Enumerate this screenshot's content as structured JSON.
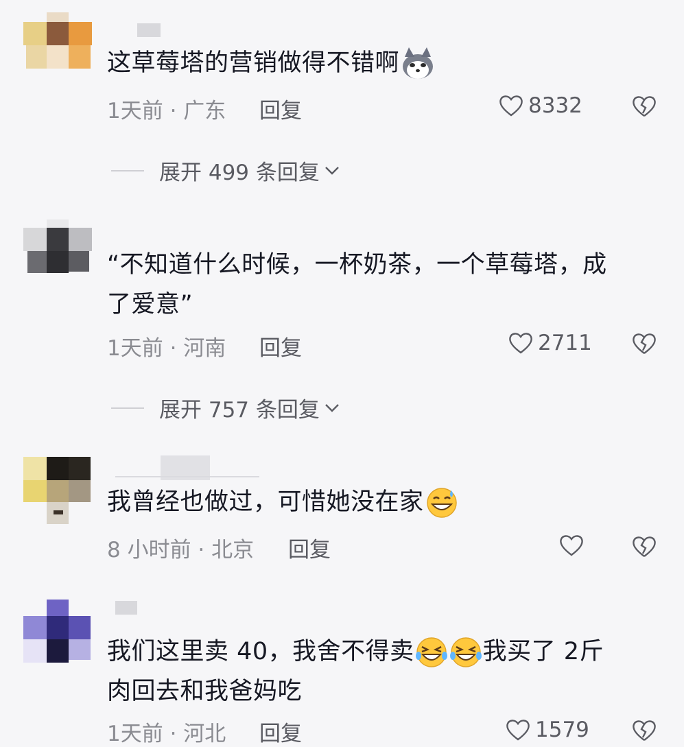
{
  "comments": [
    {
      "text": "这草莓塔的营销做得不错啊",
      "emoji": "husky-dog-emoji",
      "time_location": "1天前 · 广东",
      "reply_label": "回复",
      "likes": "8332",
      "expand_label": "展开 499 条回复"
    },
    {
      "text_line1": "“不知道什么时候，一杯奶茶，一个草莓塔，成",
      "text_line2": "了爱意”",
      "time_location": "1天前 · 河南",
      "reply_label": "回复",
      "likes": "2711",
      "expand_label": "展开 757 条回复"
    },
    {
      "text": "我曾经也做过，可惜她没在家",
      "emoji": "grinning-sweat-emoji",
      "time_location": "8 小时前 · 北京",
      "reply_label": "回复",
      "likes": ""
    },
    {
      "text_line1a": "我们这里卖 40，我舍不得卖",
      "text_line1b": "我买了 2斤",
      "text_line2": "肉回去和我爸妈吃",
      "emoji": "rolling-laughing-emoji",
      "time_location": "1天前 · 河北",
      "reply_label": "回复",
      "likes": "1579"
    }
  ],
  "colors": {
    "background": "#f6f6f8",
    "text": "#161823",
    "meta": "#8a8b91"
  }
}
